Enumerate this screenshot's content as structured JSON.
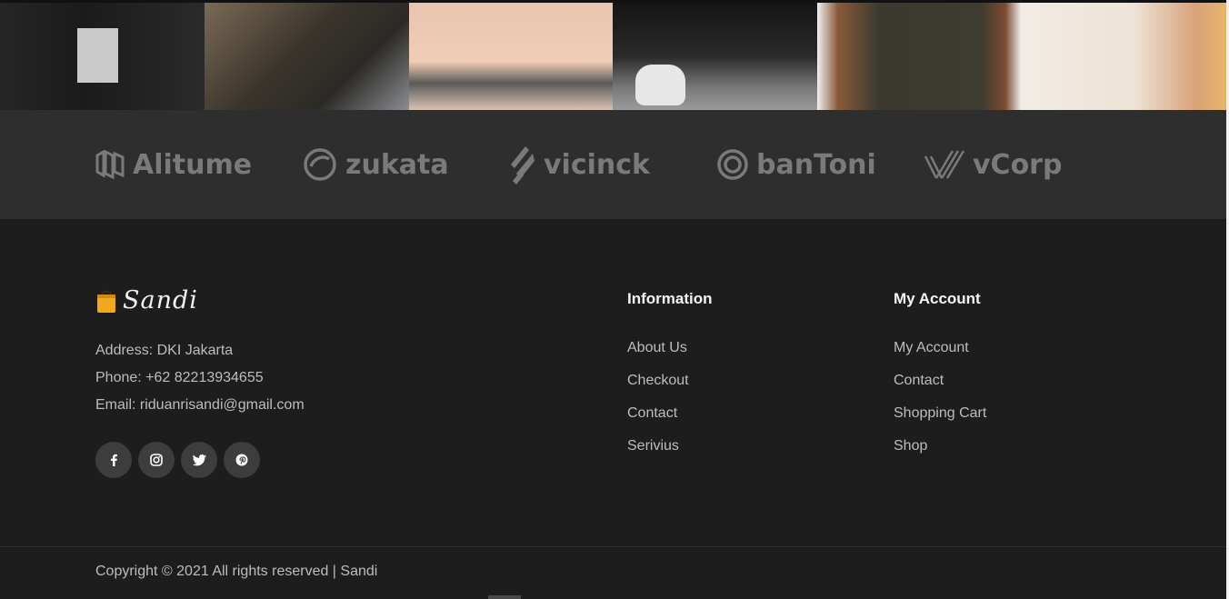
{
  "instagram": {
    "tiles": [
      "jacket",
      "mesh-top",
      "pink-sweater",
      "sneakers",
      "olive-shirt",
      "cream-sweater"
    ]
  },
  "brands": [
    "Alitume",
    "zukata",
    "vicinck",
    "banToni",
    "vCorp"
  ],
  "footer": {
    "logo": {
      "icon": "shopping-bag-icon",
      "text": "Sandi"
    },
    "contact": {
      "address": "Address: DKI Jakarta",
      "phone": "Phone: +62 82213934655",
      "email": "Email: riduanrisandi@gmail.com"
    },
    "socials": [
      "facebook-icon",
      "instagram-icon",
      "twitter-icon",
      "pinterest-icon"
    ],
    "information": {
      "title": "Information",
      "links": [
        "About Us",
        "Checkout",
        "Contact",
        "Serivius"
      ]
    },
    "account": {
      "title": "My Account",
      "links": [
        "My Account",
        "Contact",
        "Shopping Cart",
        "Shop"
      ]
    },
    "copyright": "Copyright © 2021 All rights reserved | Sandi"
  },
  "colors": {
    "footer_bg": "#1d1d1d",
    "brands_bg": "#2e2e2e",
    "brand_logo": "#7a7a7a",
    "logo_bag": "#f0a81c"
  }
}
